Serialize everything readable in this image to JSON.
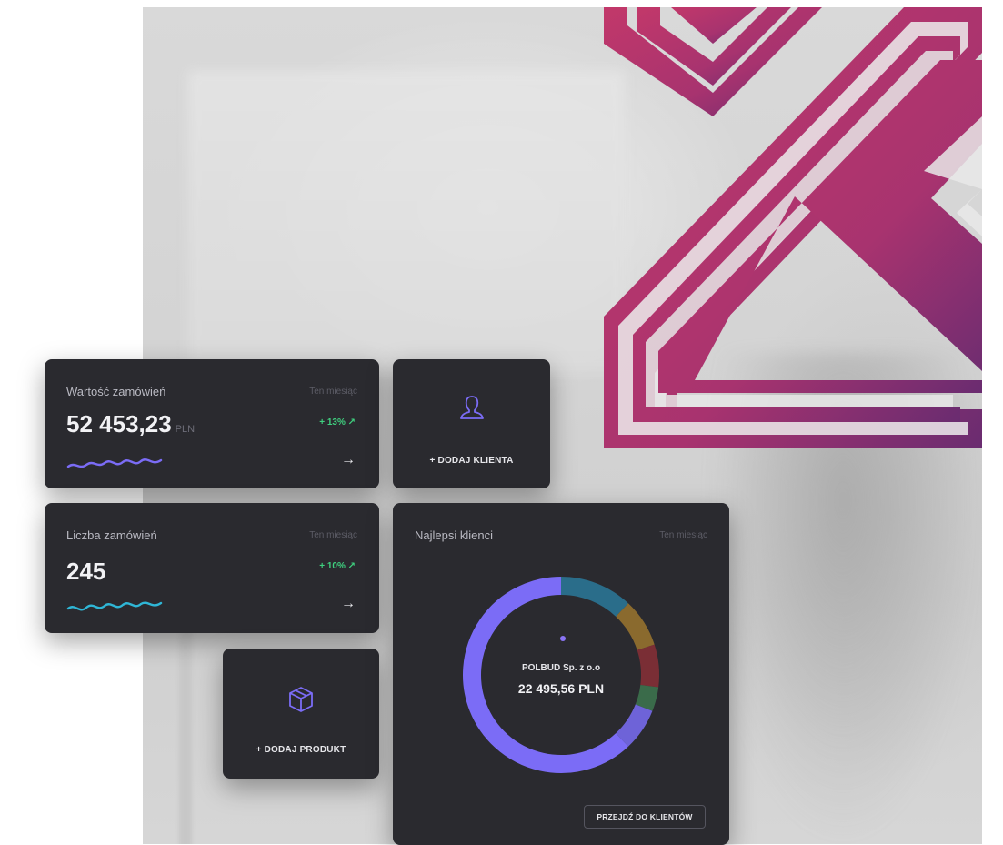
{
  "order_value": {
    "title": "Wartość zamówień",
    "period": "Ten miesiąc",
    "value": "52 453,23",
    "unit": "PLN",
    "delta": "+ 13% ↗",
    "arrow": "→"
  },
  "order_count": {
    "title": "Liczba zamówień",
    "period": "Ten miesiąc",
    "value": "245",
    "delta": "+ 10% ↗",
    "arrow": "→"
  },
  "add_client": {
    "label": "+ DODAJ KLIENTA",
    "icon": "user-icon"
  },
  "add_product": {
    "label": "+ DODAJ PRODUKT",
    "icon": "box-icon"
  },
  "top_clients": {
    "title": "Najlepsi klienci",
    "period": "Ten miesiąc",
    "client_name": "POLBUD Sp. z o.o",
    "client_amount": "22 495,56 PLN",
    "button_label": "PRZEJDŹ DO KLIENTÓW"
  },
  "colors": {
    "card_bg": "#2a2a2f",
    "accent_purple": "#7b6cf6",
    "positive_green": "#3fd07f",
    "brand_magenta": "#b23a6e"
  },
  "chart_data": {
    "type": "pie",
    "title": "Najlepsi klienci",
    "values": [
      62,
      12,
      8,
      7,
      4,
      7
    ],
    "colors": [
      "#7b6cf6",
      "#2a6d8a",
      "#8a6a2e",
      "#7a2e35",
      "#3a6b4a",
      "#6e63d8"
    ]
  }
}
